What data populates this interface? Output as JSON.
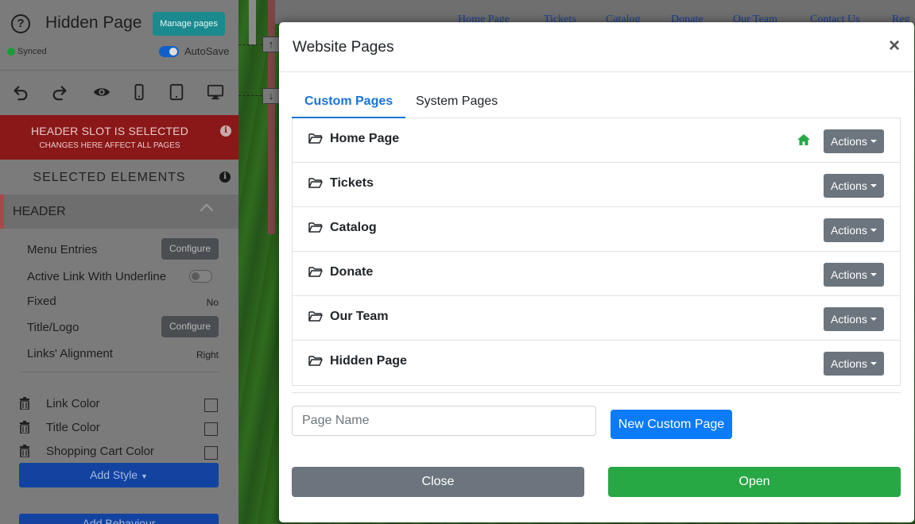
{
  "editor": {
    "page_title": "Hidden Page",
    "manage_pages_label": "Manage pages",
    "sync_status": "Synced",
    "autosave_label": "AutoSave",
    "toolbar_icons": [
      "undo-icon",
      "redo-icon",
      "preview-eye-icon",
      "mobile-icon",
      "tablet-icon",
      "desktop-icon"
    ],
    "header_slot_notice": "HEADER SLOT IS SELECTED",
    "header_slot_subnotice": "CHANGES HERE AFFECT ALL PAGES",
    "selected_elements_title": "SELECTED ELEMENTS",
    "section_title": "HEADER",
    "properties": [
      {
        "label": "Menu Entries",
        "value": "Configure"
      },
      {
        "label": "Active Link With Underline",
        "value": ""
      },
      {
        "label": "Fixed",
        "value": "No"
      },
      {
        "label": "Title/Logo",
        "value": "Configure"
      },
      {
        "label": "Links' Alignment",
        "value": "Right"
      }
    ],
    "colors": [
      {
        "label": "Link Color"
      },
      {
        "label": "Title Color"
      },
      {
        "label": "Shopping Cart Color"
      }
    ],
    "add_style_label": "Add Style",
    "add_behaviour_label": "Add Behaviour"
  },
  "preview_nav": [
    "Home Page",
    "Tickets",
    "Catalog",
    "Donate",
    "Our Team",
    "Contact Us",
    "Reg"
  ],
  "modal": {
    "title": "Website Pages",
    "close_glyph": "×",
    "tabs": [
      {
        "label": "Custom Pages",
        "active": true
      },
      {
        "label": "System Pages",
        "active": false
      }
    ],
    "pages": [
      {
        "name": "Home Page",
        "is_home": true,
        "actions_label": "Actions"
      },
      {
        "name": "Tickets",
        "is_home": false,
        "actions_label": "Actions"
      },
      {
        "name": "Catalog",
        "is_home": false,
        "actions_label": "Actions"
      },
      {
        "name": "Donate",
        "is_home": false,
        "actions_label": "Actions"
      },
      {
        "name": "Our Team",
        "is_home": false,
        "actions_label": "Actions"
      },
      {
        "name": "Hidden Page",
        "is_home": false,
        "actions_label": "Actions"
      }
    ],
    "page_name_placeholder": "Page Name",
    "page_name_value": "",
    "new_page_label": "New Custom Page",
    "close_label": "Close",
    "open_label": "Open"
  },
  "colors": {
    "primary": "#0b7bfa",
    "secondary": "#6c757d",
    "success": "#28a745",
    "active_tab": "#1a73d8",
    "header_slot": "#8a1818"
  }
}
